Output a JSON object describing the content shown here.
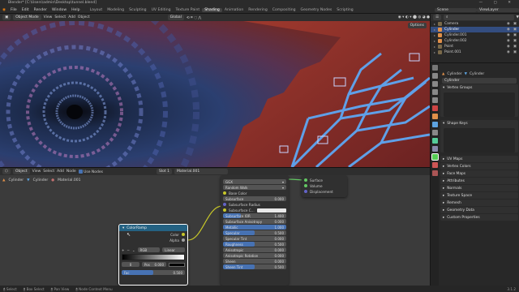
{
  "window": {
    "title": "Blender* [C:\\Users\\admin\\Desktop\\tunnel.blend]",
    "controls": "— ▢ ✕"
  },
  "menubar": {
    "menus": [
      "File",
      "Edit",
      "Render",
      "Window",
      "Help"
    ],
    "workspaces": [
      "Layout",
      "Modeling",
      "Sculpting",
      "UV Editing",
      "Texture Paint",
      "Shading",
      "Animation",
      "Rendering",
      "Compositing",
      "Geometry Nodes",
      "Scripting"
    ],
    "active_workspace": "Shading",
    "scene": "Scene",
    "view_layer": "ViewLayer"
  },
  "viewport_header": {
    "mode": "Object Mode",
    "menus": [
      "View",
      "Select",
      "Add",
      "Object"
    ],
    "orientation": "Global",
    "options": "Options"
  },
  "node_header": {
    "type": "Object",
    "menus": [
      "View",
      "Select",
      "Add",
      "Node"
    ],
    "use_nodes": "Use Nodes",
    "slot": "Slot 1",
    "material": "Material.001"
  },
  "breadcrumb": [
    "Cylinder",
    "Cylinder",
    "Material.001"
  ],
  "outliner": {
    "items": [
      {
        "name": "Camera",
        "color": "#7b6a4a",
        "selected": false
      },
      {
        "name": "Cylinder",
        "color": "#e0904a",
        "selected": true
      },
      {
        "name": "Cylinder.001",
        "color": "#e0904a",
        "selected": false
      },
      {
        "name": "Cylinder.002",
        "color": "#e0904a",
        "selected": false
      },
      {
        "name": "Point",
        "color": "#7b6a4a",
        "selected": false
      },
      {
        "name": "Point.001",
        "color": "#7b6a4a",
        "selected": false
      }
    ]
  },
  "properties": {
    "crumb": [
      "Cylinder",
      "Cylinder"
    ],
    "mesh_name": "Cylinder",
    "panels": [
      "Vertex Groups",
      "Shape Keys"
    ],
    "collapsed": [
      "UV Maps",
      "Vertex Colors",
      "Face Maps",
      "Attributes",
      "Normals",
      "Texture Space",
      "Remesh",
      "Geometry Data",
      "Custom Properties"
    ]
  },
  "bsdf": {
    "distribution": "GGX",
    "subsurface_method": "Random Walk",
    "base_color": "Base Color",
    "fields": [
      {
        "label": "Subsurface",
        "value": "0.000",
        "fill": 0
      },
      {
        "label": "Subsurface Radius",
        "value": "",
        "fill": 0
      },
      {
        "label": "Subsurface C...",
        "value": "",
        "fill": 0
      },
      {
        "label": "Subsurface IOR",
        "value": "1.400",
        "fill": 0.28
      },
      {
        "label": "Subsurface Anisotropy",
        "value": "0.000",
        "fill": 0
      },
      {
        "label": "Metallic",
        "value": "1.000",
        "fill": 1
      },
      {
        "label": "Specular",
        "value": "0.500",
        "fill": 0.5
      },
      {
        "label": "Specular Tint",
        "value": "0.000",
        "fill": 0
      },
      {
        "label": "Roughness",
        "value": "0.500",
        "fill": 0.5
      },
      {
        "label": "Anisotropic",
        "value": "0.000",
        "fill": 0
      },
      {
        "label": "Anisotropic Rotation",
        "value": "0.000",
        "fill": 0
      },
      {
        "label": "Sheen",
        "value": "0.000",
        "fill": 0
      },
      {
        "label": "Sheen Tint",
        "value": "0.500",
        "fill": 0.5
      }
    ]
  },
  "output_node": {
    "sockets": [
      "Surface",
      "Volume",
      "Displacement"
    ]
  },
  "colorramp": {
    "title": "ColorRamp",
    "outputs": [
      "Color",
      "Alpha"
    ],
    "mode": "RGB",
    "interpolation": "Linear",
    "stop_index": "0",
    "pos_label": "Pos",
    "pos_value": "0.000",
    "fac_label": "Fac",
    "fac_value": "0.500",
    "fac_fill": 0.5
  },
  "statusbar": {
    "items": [
      "Select",
      "Box Select",
      "Pan View",
      "Node Context Menu"
    ],
    "version": "3.1.2"
  }
}
